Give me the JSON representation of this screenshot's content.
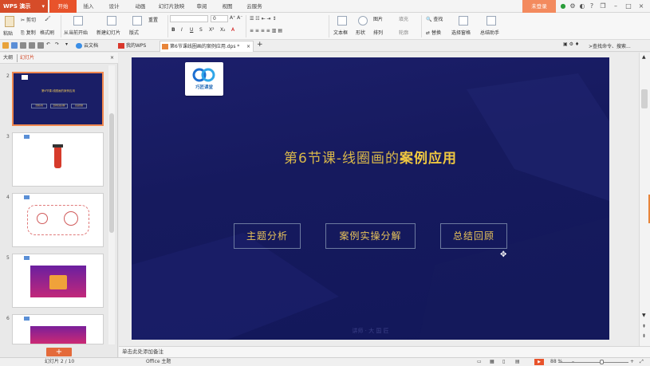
{
  "app": {
    "name": "WPS 演示"
  },
  "menu_tabs": [
    "开始",
    "插入",
    "设计",
    "动画",
    "幻灯片放映",
    "审阅",
    "视图",
    "云服务"
  ],
  "account": {
    "login_label": "未登录"
  },
  "ribbon": {
    "paste": "粘贴",
    "cut": "剪切",
    "copy": "复制",
    "format_painter": "格式刷",
    "from_current": "从当前开始",
    "new_slide": "新建幻灯片",
    "layout": "版式",
    "reset": "重置",
    "font_size": "0",
    "textbox": "文本框",
    "shape": "形状",
    "picture": "图片",
    "fill": "填充",
    "arrange": "排列",
    "outline": "轮廓",
    "find": "查找",
    "replace": "替换",
    "select_pane": "选择窗格",
    "summary_assistant": "总结助手"
  },
  "tabbar": {
    "cloud_docs": "云文档",
    "my_wps": "我的WPS",
    "active_doc": "第6节课线圈画的案例应用.dps *",
    "search_placeholder": ">查找命令、搜索..."
  },
  "left_panel": {
    "tab_outline": "大纲",
    "tab_slides": "幻灯片",
    "slide_numbers": [
      "2",
      "3",
      "4",
      "5",
      "6"
    ],
    "add_symbol": "+"
  },
  "slide": {
    "logo_text": "巧匠课堂",
    "title_prefix": "第6节课-线圈画的",
    "title_emph": "案例应用",
    "buttons": [
      "主题分析",
      "案例实操分解",
      "总结回顾"
    ],
    "footer": "讲师 · 大 国 匠"
  },
  "thumb2": {
    "title": "第6节课-线圈画的案例应用",
    "buttons": [
      "主题分析",
      "案例实操分解",
      "总结回顾"
    ]
  },
  "notes": {
    "placeholder": "单击此处添加备注"
  },
  "status": {
    "slide_info": "幻灯片 2 / 10",
    "theme": "Office 主题",
    "zoom": "88 %"
  },
  "colors": {
    "accent": "#e8532b",
    "slide_bg": "#161a5e",
    "title": "#f0c840"
  }
}
